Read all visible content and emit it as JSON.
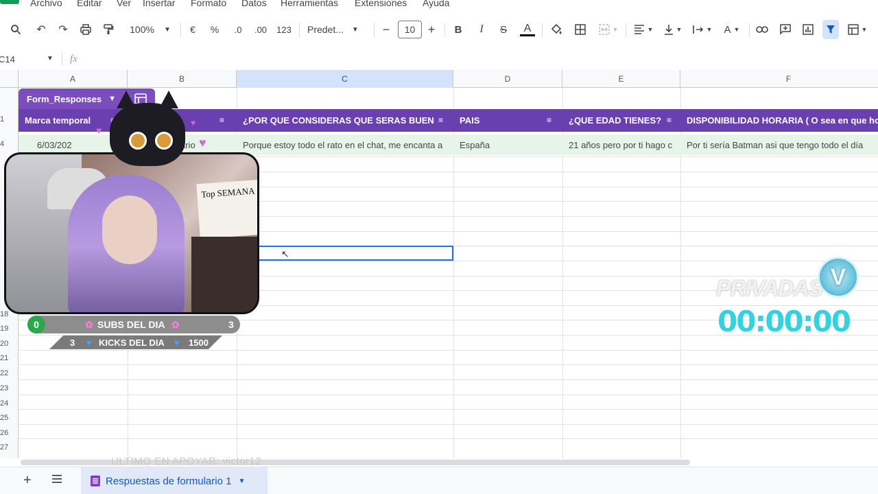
{
  "menu": {
    "items": [
      "Archivo",
      "Editar",
      "Ver",
      "Insertar",
      "Formato",
      "Datos",
      "Herramientas",
      "Extensiones",
      "Ayuda"
    ]
  },
  "toolbar": {
    "zoom": "100%",
    "currency": "€",
    "percent": "%",
    "dec_decrease": ".0",
    "dec_increase": ".00",
    "number_format": "123",
    "font": "Predet...",
    "font_size": "10",
    "bold": "B",
    "italic": "I",
    "strike": "S",
    "text_color": "A",
    "text_color_bar": "#000000"
  },
  "formula_bar": {
    "cell_ref": "C14",
    "fx": "fx",
    "value": ""
  },
  "columns": [
    "A",
    "B",
    "C",
    "D",
    "E",
    "F"
  ],
  "rows": [
    "1",
    "4",
    "",
    "",
    "",
    "",
    "",
    "",
    "",
    "",
    "",
    "",
    "",
    "",
    "",
    "",
    "18",
    "19",
    "20",
    "21",
    "22",
    "23",
    "24",
    "25",
    "26",
    "27"
  ],
  "table": {
    "name": "Form_Responses",
    "headers": [
      "Marca temporal",
      "",
      "¿POR QUE CONSIDERAS QUE SERAS BUEN M",
      "PAIS",
      "¿QUE EDAD TIENES?",
      "DISPONIBILIDAD HORARIA ( O sea en que ho"
    ],
    "header_color": "#6a3fb0",
    "row": [
      "6/03/202",
      "ario",
      "Porque estoy todo el rato en el chat, me encanta a",
      "España",
      "21 años pero por ti hago c",
      "Por ti sería Batman asi que tengo todo el día"
    ],
    "row_color": "#e6f4ea"
  },
  "overlay": {
    "subs_left": "0",
    "subs_label": "SUBS DEL DIA",
    "subs_right": "3",
    "kicks_left": "3",
    "kicks_label": "KICKS DEL DIA",
    "kicks_right": "1500",
    "privadas_label": "PRIVADAS",
    "privadas_badge": "V",
    "timer": "00:00:00",
    "cam_poster": "Top SEMANA",
    "last_support": "ULTIMO EN APOYAR: victor12"
  },
  "sheets": {
    "active": "Respuestas de formulario 1"
  }
}
